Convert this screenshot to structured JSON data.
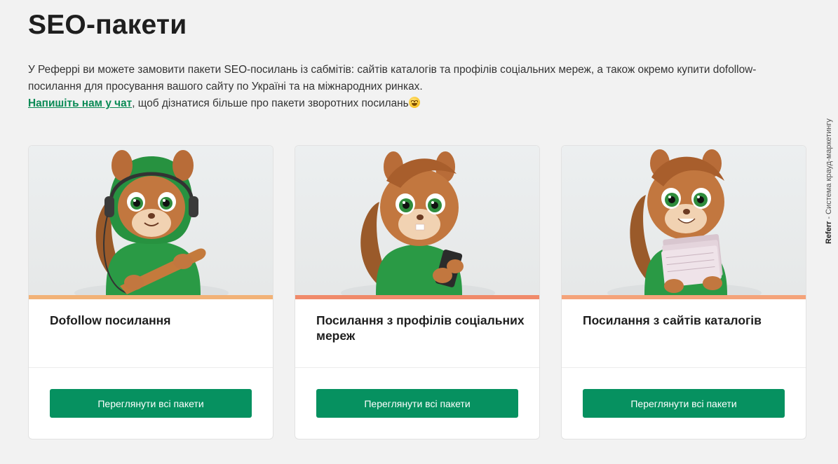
{
  "page": {
    "title": "SEO-пакети",
    "intro_text": "У Рефеpрі ви можете замовити пакети SEO-посилань із сабмітів: сайтів каталогів та профілів соціальних мереж, а також окремо купити dofollow-посилання для просування вашого сайту по Україні та на міжнародних ринках.",
    "chat_link": "Напишіть нам у чат",
    "chat_suffix": ", щоб дізнатися більше про пакети зворотних посилань"
  },
  "cards": [
    {
      "title": "Dofollow посилання",
      "button": "Переглянути всі пакети",
      "stripe_color": "#f2b277"
    },
    {
      "title": "Посилання з профілів соціальних мереж",
      "button": "Переглянути всі пакети",
      "stripe_color": "#f08a6a"
    },
    {
      "title": "Посилання з сайтів каталогів",
      "button": "Переглянути всі пакети",
      "stripe_color": "#f4a37a"
    }
  ],
  "side_label": {
    "brand": "Referr",
    "tagline": " - Система крауд-маркетингу"
  },
  "colors": {
    "accent": "#069160",
    "link": "#0a8a55",
    "background": "#f2f2f2"
  }
}
